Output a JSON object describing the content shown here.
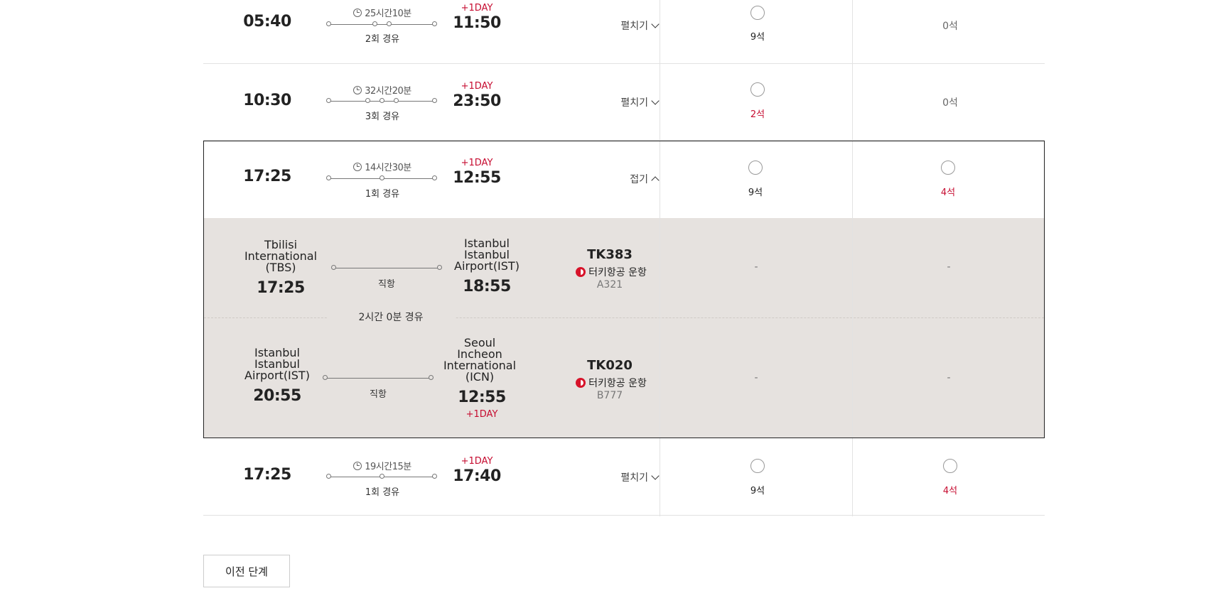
{
  "flights": [
    {
      "dep": "05:40",
      "duration": "25시간10분",
      "stops": "2회 경유",
      "plusday": "+1DAY",
      "arr": "11:50",
      "toggle": "펼치기",
      "fare1": "9석",
      "fare2": "0석"
    },
    {
      "dep": "10:30",
      "duration": "32시간20분",
      "stops": "3회 경유",
      "plusday": "+1DAY",
      "arr": "23:50",
      "toggle": "펼치기",
      "fare1": "2석",
      "fare2": "0석"
    },
    {
      "dep": "17:25",
      "duration": "14시간30분",
      "stops": "1회 경유",
      "plusday": "+1DAY",
      "arr": "12:55",
      "toggle": "접기",
      "fare1": "9석",
      "fare2": "4석"
    },
    {
      "dep": "17:25",
      "duration": "19시간15분",
      "stops": "1회 경유",
      "plusday": "+1DAY",
      "arr": "17:40",
      "toggle": "펼치기",
      "fare1": "9석",
      "fare2": "4석"
    }
  ],
  "segments": [
    {
      "from_l1": "Tbilisi",
      "from_l2": "International",
      "from_l3": "(TBS)",
      "dep": "17:25",
      "type": "직항",
      "to_l1": "Istanbul",
      "to_l2": "Istanbul",
      "to_l3": "Airport(IST)",
      "arr": "18:55",
      "flight": "TK383",
      "operator": "터키항공 운항",
      "equipment": "A321",
      "fare1": "-",
      "fare2": "-"
    },
    {
      "from_l1": "Istanbul",
      "from_l2": "Istanbul",
      "from_l3": "Airport(IST)",
      "dep": "20:55",
      "type": "직항",
      "to_l1": "Seoul",
      "to_l2": "Incheon",
      "to_l3": "International",
      "to_l4": "(ICN)",
      "arr": "12:55",
      "arr_plusday": "+1DAY",
      "flight": "TK020",
      "operator": "터키항공 운항",
      "equipment": "B777",
      "fare1": "-",
      "fare2": "-"
    }
  ],
  "layover": "2시간 0분 경유",
  "prev_button": "이전 단계",
  "icons": {
    "clock": "clock-icon",
    "chevron_down": "chevron-down-icon",
    "chevron_up": "chevron-up-icon",
    "airline": "turkish-airlines-logo-icon"
  },
  "colors": {
    "accent_red": "#c60c30",
    "detail_bg": "#e6e2df"
  }
}
